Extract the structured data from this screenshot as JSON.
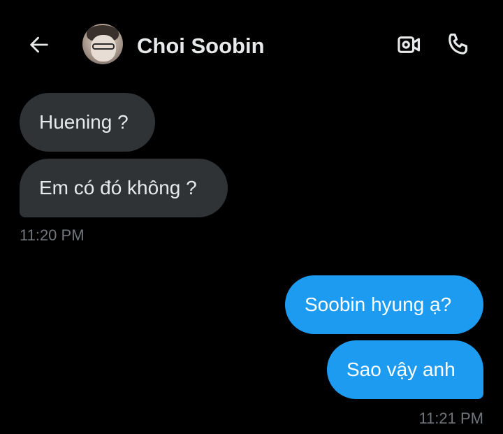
{
  "header": {
    "contact_name": "Choi Soobin",
    "back_icon": "arrow-left-icon",
    "video_icon": "video-camera-icon",
    "call_icon": "phone-icon"
  },
  "conversation": {
    "incoming": {
      "messages": [
        "Huening ?",
        "Em có đó không ?"
      ],
      "timestamp": "11:20 PM"
    },
    "outgoing": {
      "messages": [
        "Soobin hyung ạ?",
        "Sao vậy anh"
      ],
      "timestamp": "11:21 PM"
    }
  },
  "colors": {
    "background": "#000000",
    "incoming_bubble": "#2f3336",
    "outgoing_bubble": "#1d9bf0",
    "timestamp": "#71767b",
    "text": "#e7e9ea"
  }
}
